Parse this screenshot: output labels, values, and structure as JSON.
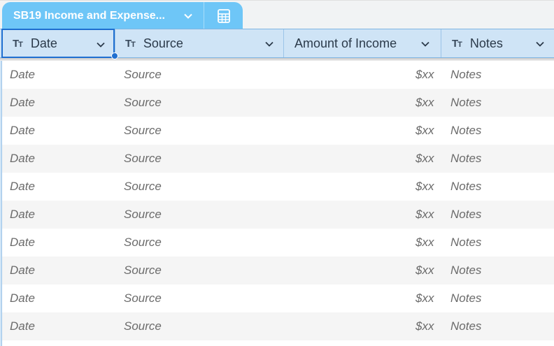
{
  "sheet_tab": {
    "title": "SB19 Income and Expense...",
    "chevron_icon": "chevron-down-icon",
    "sheet_icon": "spreadsheet-icon"
  },
  "columns": [
    {
      "label": "Date",
      "type_icon": "text-type-icon",
      "has_type_icon": true
    },
    {
      "label": "Source",
      "type_icon": "text-type-icon",
      "has_type_icon": true
    },
    {
      "label": "Amount of Income",
      "type_icon": "",
      "has_type_icon": false
    },
    {
      "label": "Notes",
      "type_icon": "text-type-icon",
      "has_type_icon": true
    }
  ],
  "type_icon_glyph": "Tт",
  "rows": [
    {
      "date": "Date",
      "source": "Source",
      "amount": "$xx",
      "notes": "Notes"
    },
    {
      "date": "Date",
      "source": "Source",
      "amount": "$xx",
      "notes": "Notes"
    },
    {
      "date": "Date",
      "source": "Source",
      "amount": "$xx",
      "notes": "Notes"
    },
    {
      "date": "Date",
      "source": "Source",
      "amount": "$xx",
      "notes": "Notes"
    },
    {
      "date": "Date",
      "source": "Source",
      "amount": "$xx",
      "notes": "Notes"
    },
    {
      "date": "Date",
      "source": "Source",
      "amount": "$xx",
      "notes": "Notes"
    },
    {
      "date": "Date",
      "source": "Source",
      "amount": "$xx",
      "notes": "Notes"
    },
    {
      "date": "Date",
      "source": "Source",
      "amount": "$xx",
      "notes": "Notes"
    },
    {
      "date": "Date",
      "source": "Source",
      "amount": "$xx",
      "notes": "Notes"
    },
    {
      "date": "Date",
      "source": "Source",
      "amount": "$xx",
      "notes": "Notes"
    }
  ],
  "colors": {
    "tab_background": "#6ec6f7",
    "header_background": "#cfe4f6",
    "selection_border": "#1f6fd0",
    "alt_row": "#f5f5f5",
    "cell_text": "#6b6b6b"
  }
}
